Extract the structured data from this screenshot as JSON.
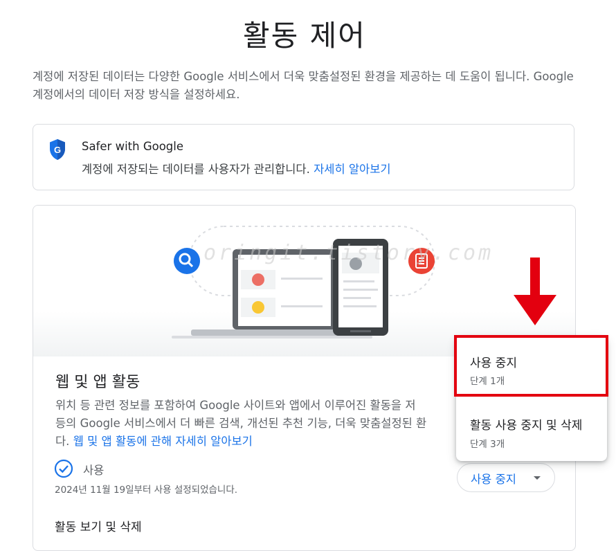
{
  "page": {
    "title": "활동 제어",
    "intro": "계정에 저장된 데이터는 다양한 Google 서비스에서 더욱 맞춤설정된 환경을 제공하는 데 도움이 됩니다. Google 계정에서의 데이터 저장 방식을 설정하세요."
  },
  "safer": {
    "title": "Safer with Google",
    "desc": "계정에 저장되는 데이터를 사용자가 관리합니다.",
    "link": "자세히 알아보기"
  },
  "web_activity": {
    "title": "웹 및 앱 활동",
    "desc_line1": "위치 등 관련 정보를 포함하여 Google 사이트와 앱에서 이루어진 활동을 저",
    "desc_line2": "등의 Google 서비스에서 더 빠른 검색, 개선된 추천 기능, 더욱 맞춤설정된 환",
    "desc_line3_prefix": "다.",
    "desc_link": "웹 및 앱 활동에 관해 자세히 알아보기",
    "status": "사용",
    "status_date": "2024년 11월 19일부터 사용 설정되었습니다.",
    "manage_title": "활동 보기 및 삭제",
    "stop_button": "사용 중지"
  },
  "menu": {
    "items": [
      {
        "label": "사용 중지",
        "sub": "단계 1개"
      },
      {
        "label": "활동 사용 중지 및 삭제",
        "sub": "단계 3개"
      }
    ]
  },
  "watermark": "oringit.tistory.com",
  "colors": {
    "accent": "#1a73e8",
    "highlight": "#e3000f",
    "search_icon": "#1a73e8",
    "doc_icon": "#ea4335"
  }
}
